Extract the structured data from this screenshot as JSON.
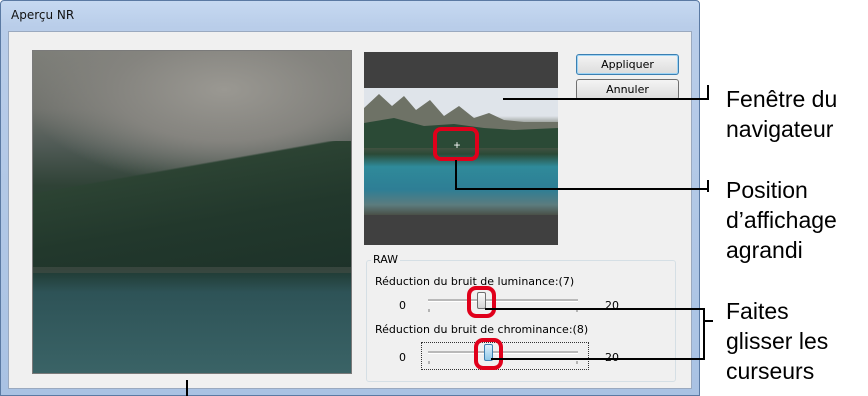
{
  "window": {
    "title": "Aperçu NR"
  },
  "buttons": {
    "apply": "Appliquer",
    "cancel": "Annuler"
  },
  "raw_group": {
    "legend": "RAW",
    "luminance": {
      "label": "Réduction du bruit de luminance:(7)",
      "min": "0",
      "max": "20",
      "value": 7
    },
    "chrominance": {
      "label": "Réduction du bruit de chrominance:(8)",
      "min": "0",
      "max": "20",
      "value": 8
    }
  },
  "callouts": {
    "navigator": [
      "Fenêtre du",
      "navigateur"
    ],
    "position": [
      "Position",
      "d’affichage",
      "agrandi"
    ],
    "sliders": [
      "Faites",
      "glisser les",
      "curseurs"
    ]
  },
  "colors": {
    "highlight": "#e0001b",
    "title_bar": "#b9cde9",
    "dialog_bg": "#f0f0f0"
  }
}
